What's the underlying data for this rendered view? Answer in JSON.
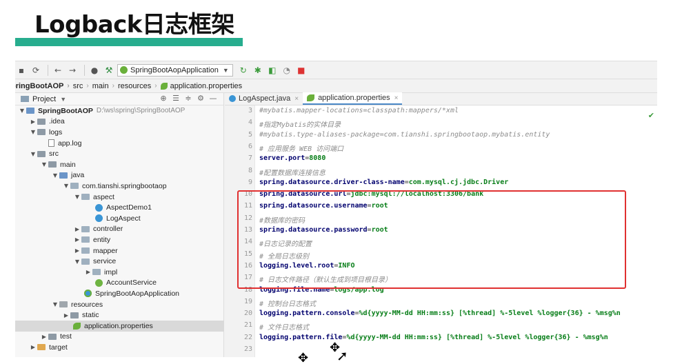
{
  "slide": {
    "title": "Logback日志框架"
  },
  "toolbar": {
    "run_config": "SpringBootAopApplication",
    "icons": [
      "save-icon",
      "sync-icon",
      "back-icon",
      "forward-icon",
      "user-icon",
      "build-icon",
      "rerun-icon",
      "debug-icon",
      "coverage-icon",
      "profile-icon",
      "stop-icon"
    ]
  },
  "breadcrumb": {
    "project": "pringBootAOP",
    "items": [
      "src",
      "main",
      "resources",
      "application.properties"
    ]
  },
  "project_panel": {
    "header": "Project",
    "tree": [
      {
        "label": "SpringBootAOP",
        "hint": "D:\\ws\\spring\\SpringBootAOP"
      },
      {
        "label": ".idea"
      },
      {
        "label": "logs"
      },
      {
        "label": "app.log"
      },
      {
        "label": "src"
      },
      {
        "label": "main"
      },
      {
        "label": "java"
      },
      {
        "label": "com.tianshi.springbootaop"
      },
      {
        "label": "aspect"
      },
      {
        "label": "AspectDemo1"
      },
      {
        "label": "LogAspect"
      },
      {
        "label": "controller"
      },
      {
        "label": "entity"
      },
      {
        "label": "mapper"
      },
      {
        "label": "service"
      },
      {
        "label": "impl"
      },
      {
        "label": "AccountService"
      },
      {
        "label": "SpringBootAopApplication"
      },
      {
        "label": "resources"
      },
      {
        "label": "static"
      },
      {
        "label": "application.properties"
      },
      {
        "label": "test"
      },
      {
        "label": "target"
      }
    ]
  },
  "editor": {
    "tabs": [
      "LogAspect.java",
      "application.properties"
    ],
    "lines": [
      {
        "n": "3",
        "key": "#mybatis.mapper-locations=classpath:mappers/*xml"
      },
      {
        "n": "4",
        "key": "#指定Mybatis的实体目录"
      },
      {
        "n": "5",
        "key": "#mybatis.type-aliases-package=com.tianshi.springbootaop.mybatis.entity"
      },
      {
        "n": "6",
        "key": "# 应用服务 WEB 访问端口"
      },
      {
        "n": "7",
        "key": "server.port",
        "val": "8080"
      },
      {
        "n": "8",
        "key": "#配置数据库连接信息"
      },
      {
        "n": "9",
        "key": "spring.datasource.driver-class-name",
        "val": "com.mysql.cj.jdbc.Driver"
      },
      {
        "n": "10",
        "key": "spring.datasource.url",
        "val": "jdbc:mysql://localhost:3306/bank"
      },
      {
        "n": "11",
        "key": "spring.datasource.username",
        "val": "root"
      },
      {
        "n": "12",
        "key": "#数据库的密码"
      },
      {
        "n": "13",
        "key": "spring.datasource.password",
        "val": "root"
      },
      {
        "n": "14",
        "key": "#日志记录的配置"
      },
      {
        "n": "15",
        "key": "# 全局日志级别"
      },
      {
        "n": "16",
        "key": "logging.level.root",
        "val": "INFO"
      },
      {
        "n": "17",
        "key": "# 日志文件路径（默认生成到项目根目录）"
      },
      {
        "n": "18",
        "key": "logging.file.name",
        "val": "logs/app.log"
      },
      {
        "n": "19",
        "key": "# 控制台日志格式"
      },
      {
        "n": "20",
        "key": "logging.pattern.console",
        "val": "%d{yyyy-MM-dd HH:mm:ss} [%thread] %-5level %logger{36} - %msg%n"
      },
      {
        "n": "21",
        "key": "# 文件日志格式"
      },
      {
        "n": "22",
        "key": "logging.pattern.file",
        "val": "%d{yyyy-MM-dd HH:mm:ss} [%thread] %-5level %logger{36} - %msg%n"
      },
      {
        "n": "23",
        "key": ""
      }
    ]
  },
  "colors": {
    "accent_bar": "#27ad8e",
    "highlight_box": "#e03030"
  }
}
